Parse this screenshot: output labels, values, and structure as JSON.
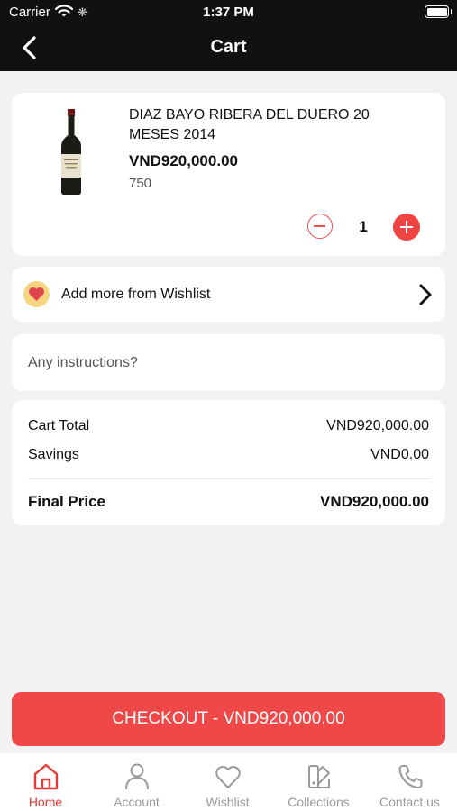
{
  "status_bar": {
    "carrier": "Carrier",
    "time": "1:37 PM"
  },
  "nav": {
    "title": "Cart"
  },
  "cart_item": {
    "name": "DIAZ BAYO RIBERA DEL DUERO 20 MESES 2014",
    "price": "VND920,000.00",
    "size": "750",
    "quantity": "1"
  },
  "wishlist": {
    "label": "Add more from Wishlist"
  },
  "instructions": {
    "placeholder": "Any instructions?"
  },
  "summary": {
    "cart_total_label": "Cart Total",
    "cart_total_value": "VND920,000.00",
    "savings_label": "Savings",
    "savings_value": "VND0.00",
    "final_label": "Final Price",
    "final_value": "VND920,000.00"
  },
  "checkout": {
    "label": "CHECKOUT - VND920,000.00"
  },
  "tabs": [
    {
      "label": "Home",
      "icon": "home-icon",
      "active": true
    },
    {
      "label": "Account",
      "icon": "person-icon",
      "active": false
    },
    {
      "label": "Wishlist",
      "icon": "heart-icon",
      "active": false
    },
    {
      "label": "Collections",
      "icon": "collections-icon",
      "active": false
    },
    {
      "label": "Contact us",
      "icon": "phone-icon",
      "active": false
    }
  ],
  "colors": {
    "accent": "#f04848",
    "header_bg": "#111111",
    "background": "#f2f2f2",
    "tab_inactive": "#9a9a9a"
  }
}
